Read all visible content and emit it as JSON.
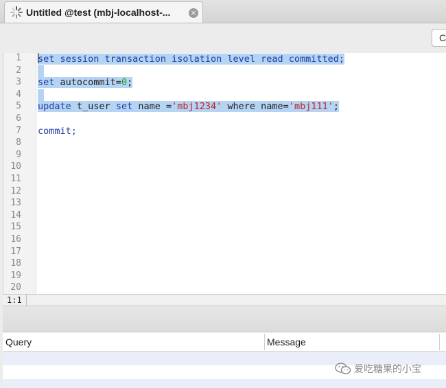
{
  "tab": {
    "title": "Untitled @test (mbj-localhost-...",
    "close_glyph": "×"
  },
  "toolbar": {
    "button_label": "C"
  },
  "editor": {
    "line_numbers": [
      "1",
      "2",
      "3",
      "4",
      "5",
      "6",
      "7",
      "8",
      "9",
      "10",
      "11",
      "12",
      "13",
      "14",
      "15",
      "16",
      "17",
      "18",
      "19",
      "20"
    ],
    "code": {
      "line1": {
        "k1": "set",
        "t1": " session transaction isolation level read committed;"
      },
      "line3": {
        "k1": "set",
        "t1": " autocommit=",
        "n1": "0",
        "t2": ";"
      },
      "line5": {
        "k1": "update",
        "t1": " t_user ",
        "k2": "set",
        "t2": " name =",
        "s1": "'mbj1234'",
        "t3": " where name=",
        "s2": "'mbj111'",
        "t4": ";"
      },
      "line7": {
        "t1": "commit;"
      }
    }
  },
  "status": {
    "cursor_position": "1:1"
  },
  "results": {
    "columns": [
      "Query",
      "Message"
    ]
  },
  "watermark": {
    "text": "爱吃糖果的小宝",
    "icon": "wechat-icon"
  },
  "colors": {
    "selection": "#b5d3f3",
    "keyword": "#1f3ea0",
    "string": "#c02525",
    "number": "#1aa21a"
  }
}
